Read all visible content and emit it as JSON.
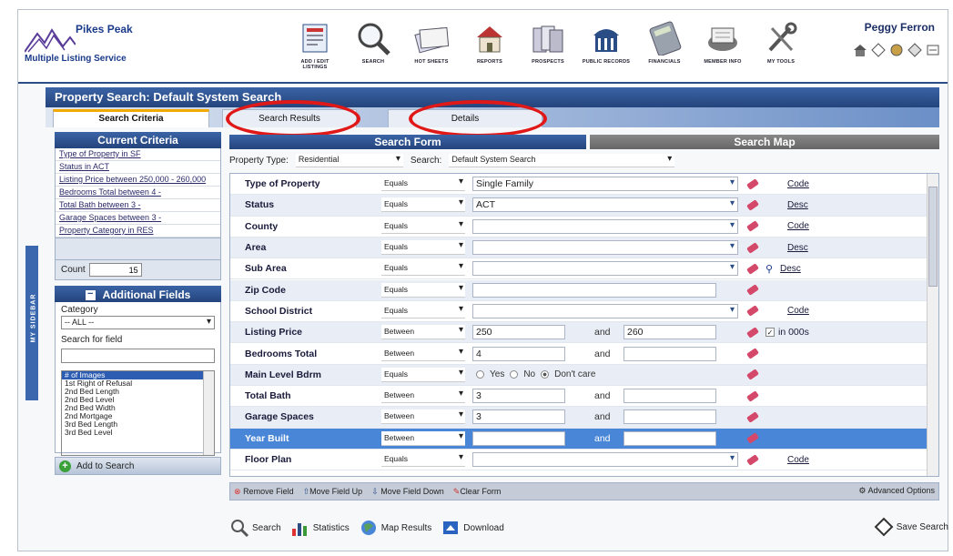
{
  "app": {
    "logo_line1": "Pikes Peak",
    "logo_line2": "Multiple Listing Service",
    "user": "Peggy Ferron"
  },
  "nav": [
    {
      "label": "ADD / EDIT LISTINGS",
      "icon": "listings-icon"
    },
    {
      "label": "SEARCH",
      "icon": "magnifier-icon"
    },
    {
      "label": "HOT SHEETS",
      "icon": "hot-sheets-icon"
    },
    {
      "label": "REPORTS",
      "icon": "reports-icon"
    },
    {
      "label": "PROSPECTS",
      "icon": "prospects-icon"
    },
    {
      "label": "PUBLIC RECORDS",
      "icon": "public-records-icon"
    },
    {
      "label": "FINANCIALS",
      "icon": "calculator-icon"
    },
    {
      "label": "MEMBER INFO",
      "icon": "rolodex-icon"
    },
    {
      "label": "MY TOOLS",
      "icon": "tools-icon"
    }
  ],
  "sidebar_label": "MY SIDEBAR",
  "page_title": "Property Search:   Default System Search",
  "tabs": {
    "criteria": "Search Criteria",
    "results": "Search Results",
    "details": "Details"
  },
  "current_criteria": {
    "title": "Current Criteria",
    "items": [
      "Type of Property in SF",
      "Status in ACT",
      "Listing Price between 250,000 - 260,000",
      "Bedrooms Total between 4 -",
      "Total Bath between 3 -",
      "Garage Spaces between 3 -",
      "Property Category in RES"
    ],
    "count_label": "Count",
    "count_value": "15"
  },
  "additional_fields": {
    "title": "Additional Fields",
    "category_label": "Category",
    "category_value": "-- ALL --",
    "search_label": "Search for field",
    "fields": [
      "# of Images",
      "1st Right of Refusal",
      "2nd Bed Length",
      "2nd Bed Level",
      "2nd Bed Width",
      "2nd Mortgage",
      "3rd Bed Length",
      "3rd Bed Level"
    ],
    "add_button": "Add to Search"
  },
  "form_tabs": {
    "form": "Search Form",
    "map": "Search Map"
  },
  "property_type": {
    "label": "Property Type:",
    "value": "Residential",
    "search_label": "Search:",
    "search_value": "Default System Search"
  },
  "fields": [
    {
      "name": "Type of Property",
      "op": "Equals",
      "value": "Single Family",
      "link": "Code"
    },
    {
      "name": "Status",
      "op": "Equals",
      "value": "ACT",
      "link": "Desc"
    },
    {
      "name": "County",
      "op": "Equals",
      "value": "",
      "link": "Code"
    },
    {
      "name": "Area",
      "op": "Equals",
      "value": "",
      "link": "Desc"
    },
    {
      "name": "Sub Area",
      "op": "Equals",
      "value": "",
      "link": "Desc"
    },
    {
      "name": "Zip Code",
      "op": "Equals",
      "value": ""
    },
    {
      "name": "School District",
      "op": "Equals",
      "value": "",
      "link": "Code"
    },
    {
      "name": "Listing Price",
      "op": "Between",
      "value": "250",
      "and": "and",
      "value2": "260",
      "check_label": "in 000s"
    },
    {
      "name": "Bedrooms Total",
      "op": "Between",
      "value": "4",
      "and": "and",
      "value2": ""
    },
    {
      "name": "Main Level Bdrm",
      "op": "Equals",
      "radio_yes": "Yes",
      "radio_no": "No",
      "radio_dc": "Don't care"
    },
    {
      "name": "Total Bath",
      "op": "Between",
      "value": "3",
      "and": "and",
      "value2": ""
    },
    {
      "name": "Garage Spaces",
      "op": "Between",
      "value": "3",
      "and": "and",
      "value2": ""
    },
    {
      "name": "Year Built",
      "op": "Between",
      "value": "",
      "and": "and",
      "value2": ""
    },
    {
      "name": "Floor Plan",
      "op": "Equals",
      "value": "",
      "link": "Code"
    }
  ],
  "toolbar": {
    "remove": "Remove Field",
    "up": "Move Field Up",
    "down": "Move Field Down",
    "clear": "Clear Form",
    "advanced": "Advanced Options"
  },
  "actions": {
    "search": "Search",
    "statistics": "Statistics",
    "map": "Map Results",
    "download": "Download",
    "save": "Save Search"
  },
  "colors": {
    "primary": "#2a4d86",
    "highlight_row": "#4a86d8",
    "annotation": "#e01818"
  }
}
